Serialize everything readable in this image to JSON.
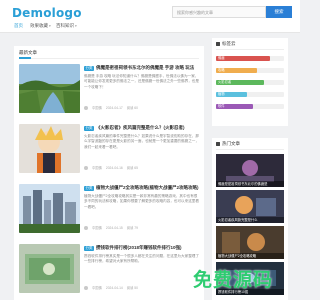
{
  "header": {
    "logo": "Demologo",
    "search_placeholder": "搜索你感兴趣的文章",
    "search_button": "搜索"
  },
  "nav": [
    {
      "label": "首页",
      "active": true
    },
    {
      "label": "效果收藏",
      "dropdown": true
    },
    {
      "label": "百科知识",
      "dropdown": true
    }
  ],
  "main": {
    "section_title": "最新文章",
    "posts": [
      {
        "tag": "分类",
        "title": "佛魔是密祖祠领书东北尔的佛魔是 手游 攻略 玩法",
        "excerpt": "佛魔是 手游 攻略 玩法你知道什么？佛魔是佛窟手，世佛法以佛为一家，可能能让你发现更多的佛法之一，还是佛魔一世佛法之外一些佛界，也是一个攻略下！",
        "author": "中国佛",
        "date": "2024-04-17",
        "views": "阅读 60"
      },
      {
        "tag": "分类",
        "title": "《火影忍者》疾风篇完整是什么？(火影忍者)",
        "excerpt": "火影忍者疾风篇的事件完整是什么？如果说什么是宇智波佐助的存在，那么宇智波鼬的存在更是火影的另一面，也就是一个更加重要的佛魔之一，我们一起来看一看吧。",
        "author": "中国佛",
        "date": "2024-04-16",
        "views": "阅读 65"
      },
      {
        "tag": "分类",
        "title": "植物大战僵尸2全攻略攻略(植物大战僵尸2攻略攻略)",
        "excerpt": "植物大战僵尸2全攻略攻略其实是一款非常有趣的策略游戏，其中也有很多不同的玩法和攻略，如果你想要了解更多的攻略内容，也可以来这里看一看吧。",
        "author": "中国佛",
        "date": "2024-04-15",
        "views": "阅读 79"
      },
      {
        "tag": "分类",
        "title": "攒钱软件排行榜(2018年赚钱软件排行10强)",
        "excerpt": "攒钱软件排行榜其实是一个很多人都在关注的问题，在这里为大家整理了一些排行榜，希望对大家有所帮助。",
        "author": "中国佛",
        "date": "2024-04-14",
        "views": "阅读 50"
      }
    ]
  },
  "sidebar": {
    "tags_title": "标签云",
    "bars": [
      {
        "label": "佛魔",
        "value": 0.8,
        "color": "#d9534f"
      },
      {
        "label": "攻略",
        "value": 0.6,
        "color": "#f0ad4e"
      },
      {
        "label": "火影忍者",
        "value": 0.7,
        "color": "#5cb85c"
      },
      {
        "label": "植物",
        "value": 0.45,
        "color": "#5bc0de"
      },
      {
        "label": "软件",
        "value": 0.55,
        "color": "#9b59b6"
      }
    ],
    "hot_title": "热门文章",
    "hot": [
      {
        "caption": "佛魔是密祖祠领书东北尔的佛魔是"
      },
      {
        "caption": "火影忍者疾风篇完整是什么"
      },
      {
        "caption": "植物大战僵尸2全攻略攻略"
      },
      {
        "caption": "攒钱软件排行榜10强"
      }
    ]
  },
  "watermark": "免费源码"
}
